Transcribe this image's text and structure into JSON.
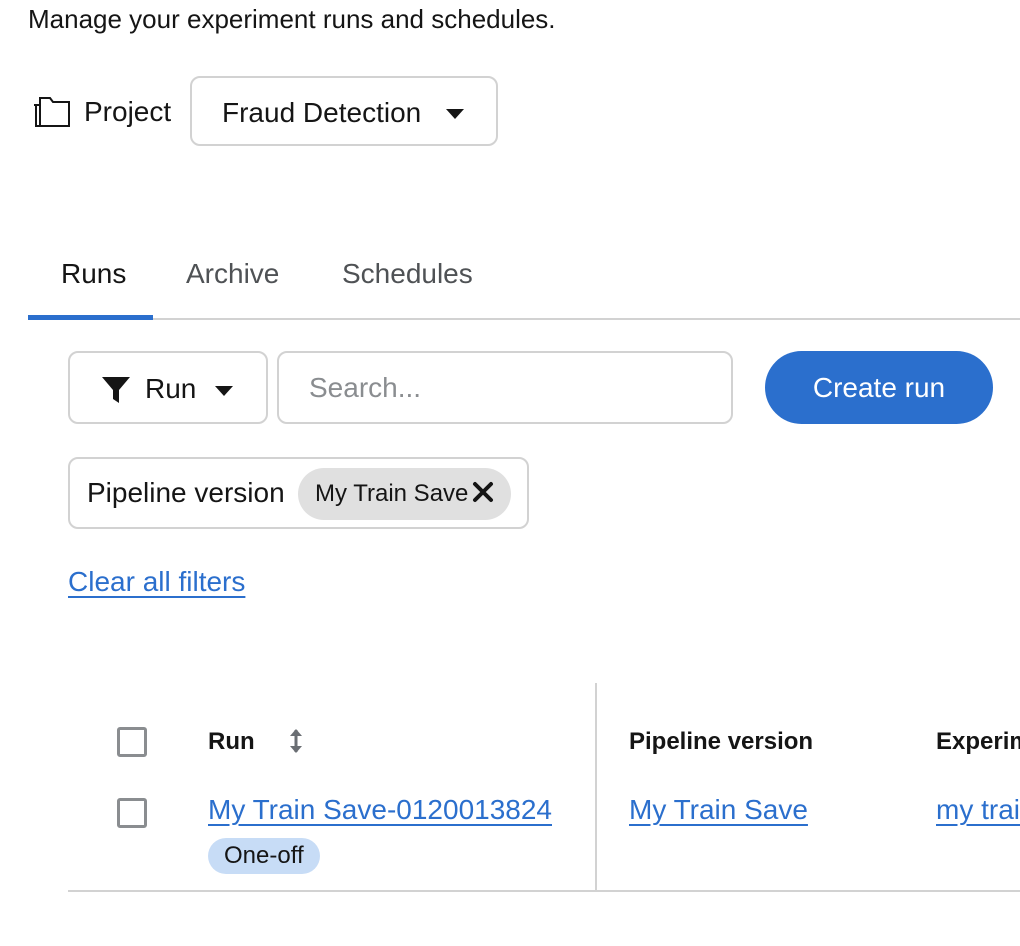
{
  "page": {
    "subtitle": "Manage your experiment runs and schedules."
  },
  "project": {
    "icon": "folder-icon",
    "label": "Project",
    "selected": "Fraud Detection"
  },
  "tabs": [
    {
      "label": "Runs",
      "active": true
    },
    {
      "label": "Archive",
      "active": false
    },
    {
      "label": "Schedules",
      "active": false
    }
  ],
  "toolbar": {
    "filter_icon": "filter-icon",
    "filter_attribute": "Run",
    "search_placeholder": "Search...",
    "create_label": "Create run"
  },
  "active_filters": {
    "category": "Pipeline version",
    "chips": [
      {
        "label": "My Train Save"
      }
    ],
    "clear_label": "Clear all filters"
  },
  "table": {
    "columns": [
      "Run",
      "Pipeline version",
      "Experiment"
    ],
    "rows": [
      {
        "run": "My Train Save-0120013824",
        "run_badge": "One-off",
        "pipeline_version": "My Train Save",
        "experiment": "my train"
      }
    ]
  },
  "colors": {
    "primary": "#2b6fcd",
    "border": "#d2d2d2",
    "chip_bg": "#e0e0e0",
    "badge_bg": "#c7dcf6"
  }
}
